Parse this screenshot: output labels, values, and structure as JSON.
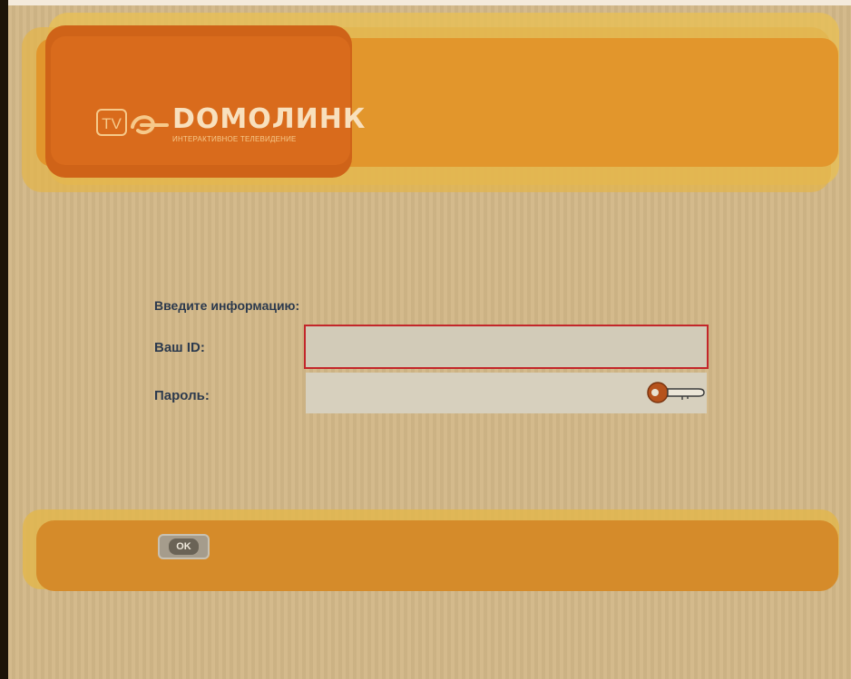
{
  "brand": {
    "tv_badge": "TV",
    "name": "DOMOЛИНК",
    "tagline": "ИНТЕРАКТИВНОЕ ТЕЛЕВИДЕНИЕ"
  },
  "form": {
    "heading": "Введите информацию:",
    "id_label": "Ваш ID:",
    "id_value": "",
    "password_label": "Пароль:",
    "password_value": ""
  },
  "footer": {
    "ok_label": "OK"
  },
  "colors": {
    "background": "#d2b888",
    "header_orange": "#e2962c",
    "logo_orange": "#d96b1c",
    "focus_border": "#c3262a",
    "text": "#2c3a4e"
  },
  "icons": {
    "password_key": "key-icon",
    "logo_swirl": "swirl-icon"
  }
}
